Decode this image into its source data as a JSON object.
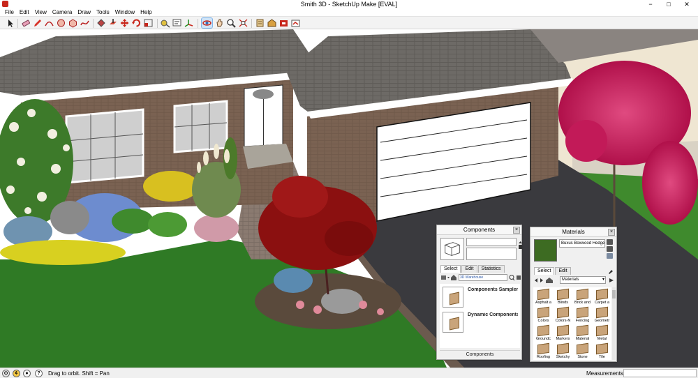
{
  "window": {
    "title": "Smith 3D - SketchUp Make [EVAL]",
    "minimize": "−",
    "maximize": "□",
    "close": "✕"
  },
  "menu": [
    "File",
    "Edit",
    "View",
    "Camera",
    "Draw",
    "Tools",
    "Window",
    "Help"
  ],
  "toolbar": {
    "tools": [
      "select-icon",
      "eraser-icon",
      "pencil-icon",
      "arc-icon",
      "circle-icon",
      "polygon-icon",
      "freehand-icon",
      "paint-bucket-icon",
      "push-pull-icon",
      "move-icon",
      "rotate-icon",
      "scale-icon",
      "tape-measure-icon",
      "text-icon",
      "axes-icon",
      "orbit-icon",
      "pan-icon",
      "zoom-icon",
      "zoom-extents-icon",
      "previous-view-icon",
      "warehouse-icon",
      "extension-warehouse-icon",
      "share-model-icon"
    ],
    "active_tool": "orbit-icon"
  },
  "components_panel": {
    "title": "Components",
    "tabs": [
      "Select",
      "Edit",
      "Statistics"
    ],
    "url": "3D Warehouse",
    "url_sub": "Components Sampler",
    "items": [
      "Components Sampler",
      "Dynamic Components Tr..."
    ],
    "footer": "Components"
  },
  "materials_panel": {
    "title": "Materials",
    "current_material": "Buxus Boxwood Hedge (",
    "tabs": [
      "Select",
      "Edit"
    ],
    "library": "Materials",
    "items": [
      "Asphalt a",
      "Blinds",
      "Brick and",
      "Carpet a",
      "Colors",
      "Colors-N",
      "Fencing",
      "Geometr",
      "Groundc",
      "Markers",
      "Material",
      "Metal",
      "Roofing",
      "Sketchy",
      "Stone",
      "Tile"
    ]
  },
  "statusbar": {
    "hint": "Drag to orbit.  Shift = Pan",
    "measurements_label": "Measurements",
    "measurements_value": ""
  },
  "colors": {
    "roof": "#6d6a66",
    "brick": "#7a6252",
    "lawn": "#2f7a25",
    "driveway": "#3a3a3e",
    "blossom": "#c21a58",
    "maple": "#8b1010"
  }
}
